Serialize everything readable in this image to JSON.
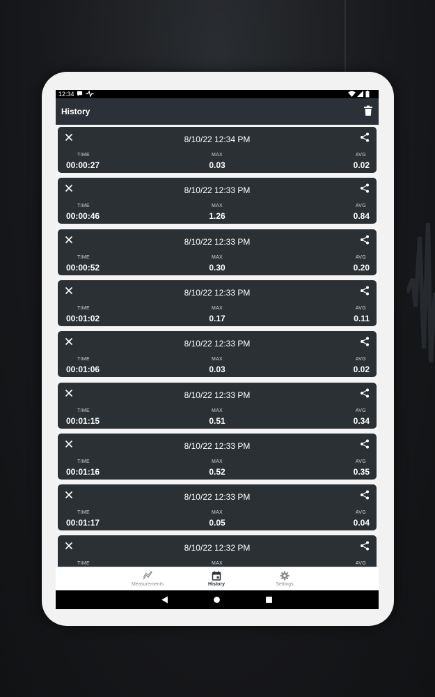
{
  "status_bar": {
    "time": "12:34",
    "left_icons": [
      "chat-bubble-icon",
      "pulse-icon"
    ],
    "right_icons": [
      "wifi-icon",
      "signal-icon",
      "battery-icon"
    ]
  },
  "app_bar": {
    "title": "History",
    "action_icon": "trash-icon"
  },
  "history": [
    {
      "date": "8/10/22 12:34 PM",
      "time_label": "TIME",
      "time": "00:00:27",
      "max_label": "MAX",
      "max": "0.03",
      "avg_label": "AVG",
      "avg": "0.02"
    },
    {
      "date": "8/10/22 12:33 PM",
      "time_label": "TIME",
      "time": "00:00:46",
      "max_label": "MAX",
      "max": "1.26",
      "avg_label": "AVG",
      "avg": "0.84"
    },
    {
      "date": "8/10/22 12:33 PM",
      "time_label": "TIME",
      "time": "00:00:52",
      "max_label": "MAX",
      "max": "0.30",
      "avg_label": "AVG",
      "avg": "0.20"
    },
    {
      "date": "8/10/22 12:33 PM",
      "time_label": "TIME",
      "time": "00:01:02",
      "max_label": "MAX",
      "max": "0.17",
      "avg_label": "AVG",
      "avg": "0.11"
    },
    {
      "date": "8/10/22 12:33 PM",
      "time_label": "TIME",
      "time": "00:01:06",
      "max_label": "MAX",
      "max": "0.03",
      "avg_label": "AVG",
      "avg": "0.02"
    },
    {
      "date": "8/10/22 12:33 PM",
      "time_label": "TIME",
      "time": "00:01:15",
      "max_label": "MAX",
      "max": "0.51",
      "avg_label": "AVG",
      "avg": "0.34"
    },
    {
      "date": "8/10/22 12:33 PM",
      "time_label": "TIME",
      "time": "00:01:16",
      "max_label": "MAX",
      "max": "0.52",
      "avg_label": "AVG",
      "avg": "0.35"
    },
    {
      "date": "8/10/22 12:33 PM",
      "time_label": "TIME",
      "time": "00:01:17",
      "max_label": "MAX",
      "max": "0.05",
      "avg_label": "AVG",
      "avg": "0.04"
    },
    {
      "date": "8/10/22 12:32 PM",
      "time_label": "TIME",
      "time": "",
      "max_label": "MAX",
      "max": "",
      "avg_label": "AVG",
      "avg": ""
    }
  ],
  "bottom_nav": {
    "items": [
      {
        "label": "Measurements",
        "icon": "chart-line-icon",
        "active": false
      },
      {
        "label": "History",
        "icon": "calendar-icon",
        "active": true
      },
      {
        "label": "Settings",
        "icon": "gear-icon",
        "active": false
      }
    ]
  },
  "system_nav": {
    "icons": [
      "back-triangle-icon",
      "home-circle-icon",
      "recents-square-icon"
    ]
  },
  "colors": {
    "app_bar": "#2b3136",
    "card": "#2b3035",
    "list_background": "#f4f4f4",
    "nav_active": "#2b3136",
    "nav_inactive": "#8a8f94"
  }
}
